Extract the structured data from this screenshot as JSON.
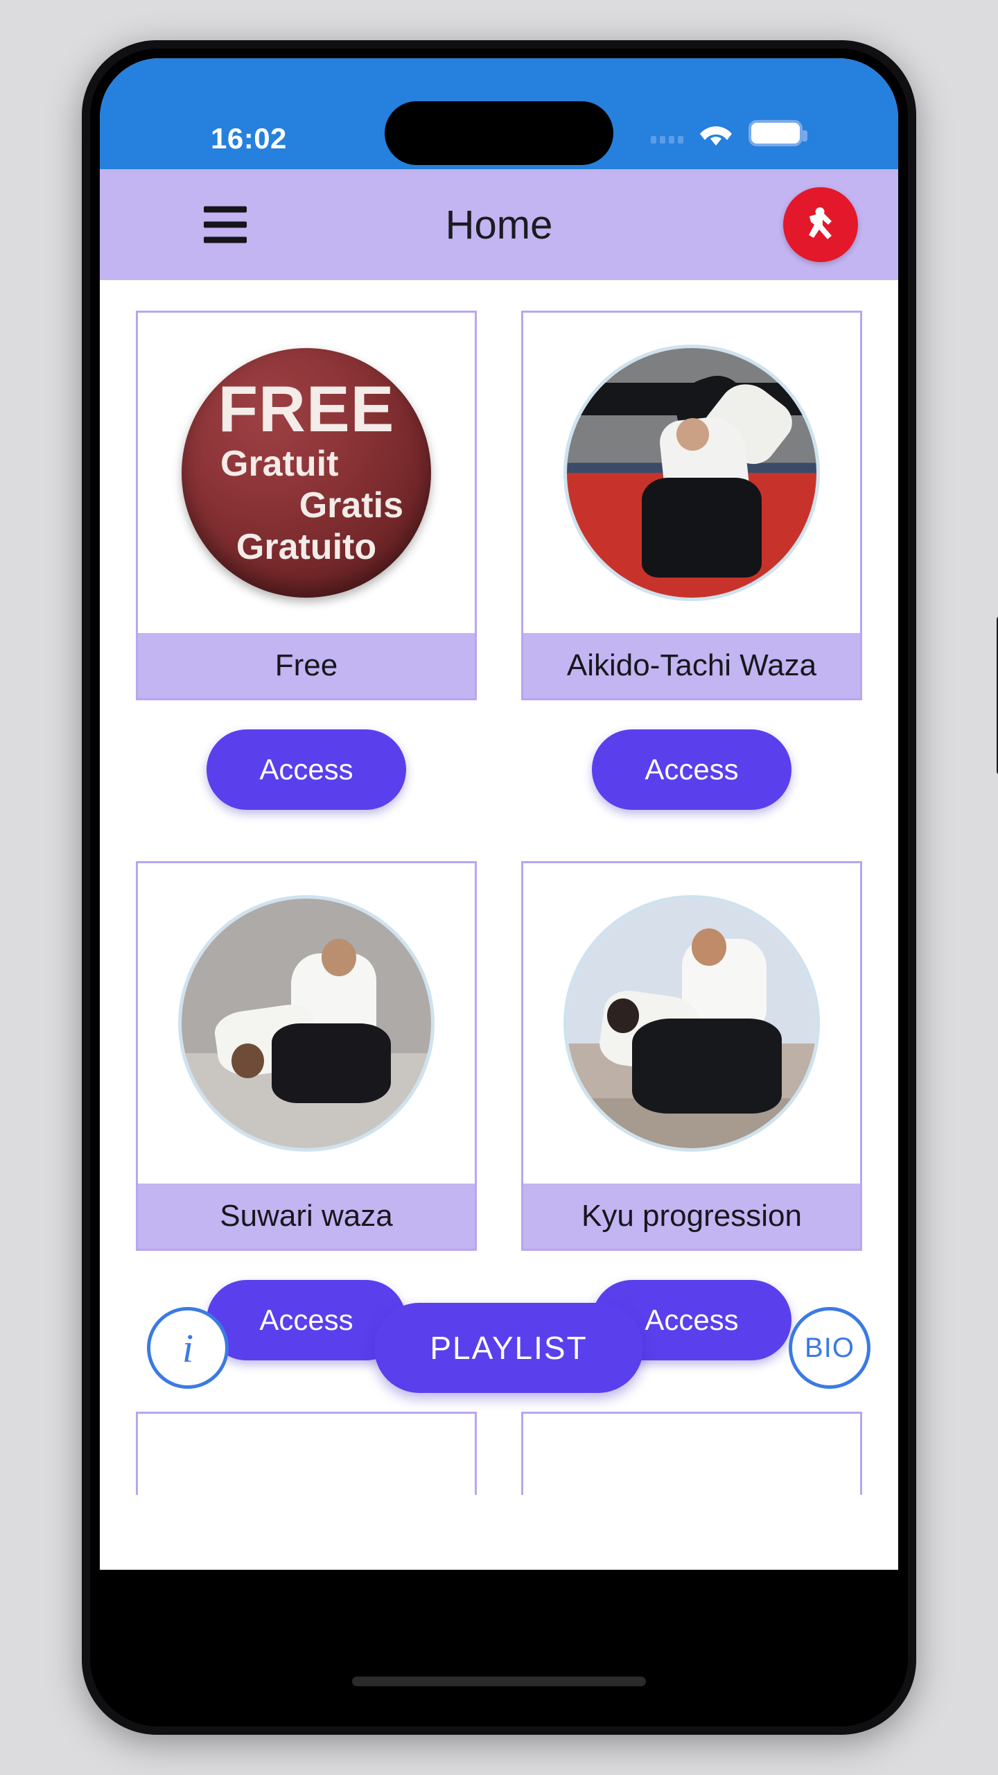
{
  "status_bar": {
    "time": "16:02",
    "signal_icon": "signal-dots-icon",
    "wifi_icon": "wifi-icon",
    "battery_icon": "battery-icon",
    "background_color": "#2680dd"
  },
  "header": {
    "title": "Home",
    "menu_icon": "hamburger-menu-icon",
    "logo_icon": "aikido-figure-logo-icon",
    "background_color": "#c3b4f2",
    "logo_color": "#e3182a"
  },
  "cards": [
    {
      "label": "Free",
      "button_label": "Access",
      "media_type": "free-badge",
      "badge_lines": [
        "FREE",
        "Gratuit",
        "Gratis",
        "Gratuito"
      ]
    },
    {
      "label": "Aikido-Tachi Waza",
      "button_label": "Access",
      "media_type": "photo-tachi-waza"
    },
    {
      "label": "Suwari waza",
      "button_label": "Access",
      "media_type": "photo-suwari-waza"
    },
    {
      "label": "Kyu progression",
      "button_label": "Access",
      "media_type": "photo-kyu-progression"
    }
  ],
  "bottom_bar": {
    "info_label": "i",
    "playlist_label": "PLAYLIST",
    "bio_label": "BIO",
    "accent_color": "#5a3fec",
    "circle_border_color": "#3a7ae4"
  }
}
